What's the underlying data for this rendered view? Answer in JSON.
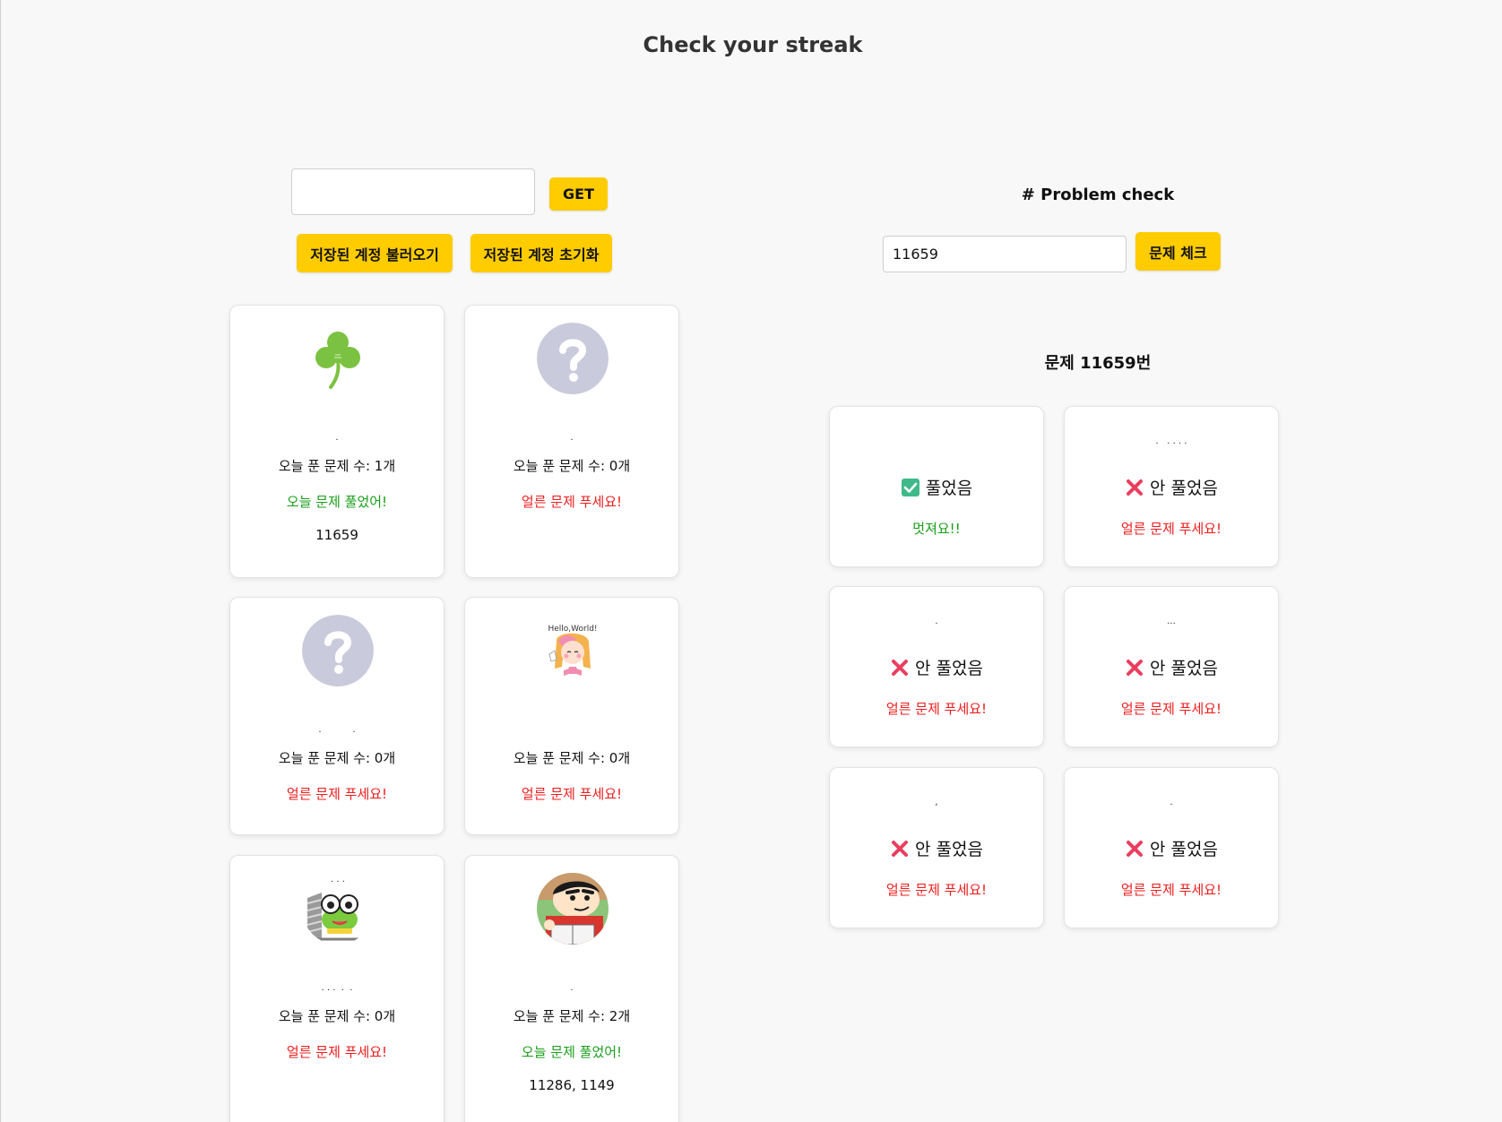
{
  "page": {
    "title": "Check your streak"
  },
  "account": {
    "id_value": "",
    "get_label": "GET",
    "load_label": "저장된 계정 불러오기",
    "reset_label": "저장된 계정 초기화"
  },
  "users": [
    {
      "avatar": "clover-icon",
      "count_text": "오늘 푼 문제 수: 1개",
      "status_text": "오늘 문제 풀었어!",
      "status": "ok",
      "problems_text": "11659"
    },
    {
      "avatar": "question-mark-icon",
      "count_text": "오늘 푼 문제 수: 0개",
      "status_text": "얼른 문제 푸세요!",
      "status": "bad",
      "problems_text": ""
    },
    {
      "avatar": "question-mark-icon",
      "count_text": "오늘 푼 문제 수: 0개",
      "status_text": "얼른 문제 푸세요!",
      "status": "bad",
      "problems_text": ""
    },
    {
      "avatar": "hello-world-girl-icon",
      "count_text": "오늘 푼 문제 수: 0개",
      "status_text": "얼른 문제 푸세요!",
      "status": "bad",
      "problems_text": "",
      "avatar_text": "Hello,World!"
    },
    {
      "avatar": "green-frog-icon",
      "count_text": "오늘 푼 문제 수: 0개",
      "status_text": "얼른 문제 푸세요!",
      "status": "bad",
      "problems_text": ""
    },
    {
      "avatar": "cartoon-boy-icon",
      "count_text": "오늘 푼 문제 수: 2개",
      "status_text": "오늘 문제 풀었어!",
      "status": "ok",
      "problems_text": "11286, 1149"
    }
  ],
  "problem_check": {
    "heading": "# Problem check",
    "input_value": "11659",
    "button_label": "문제 체크",
    "result_heading": "문제 11659번",
    "results": [
      {
        "icon": "green-check-icon",
        "status_text": "풀었음",
        "message": "멋져요!!",
        "status": "ok"
      },
      {
        "icon": "red-x-icon",
        "status_text": "안 풀었음",
        "message": "얼른 문제 푸세요!",
        "status": "bad"
      },
      {
        "icon": "red-x-icon",
        "status_text": "안 풀었음",
        "message": "얼른 문제 푸세요!",
        "status": "bad"
      },
      {
        "icon": "red-x-icon",
        "status_text": "안 풀었음",
        "message": "얼른 문제 푸세요!",
        "status": "bad"
      },
      {
        "icon": "red-x-icon",
        "status_text": "안 풀었음",
        "message": "얼른 문제 푸세요!",
        "status": "bad"
      },
      {
        "icon": "red-x-icon",
        "status_text": "안 풀었음",
        "message": "얼른 문제 푸세요!",
        "status": "bad"
      }
    ]
  },
  "colors": {
    "button": "#ffcc00",
    "ok": "#1a9e1a",
    "bad": "#ee1c1c",
    "placeholder_avatar": "#c9cadb"
  }
}
